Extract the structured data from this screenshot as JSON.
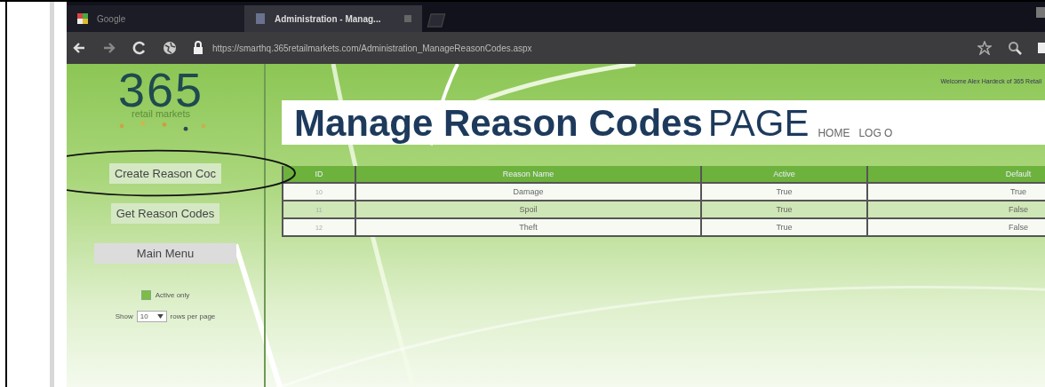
{
  "browser": {
    "tabs": [
      {
        "title": "Google",
        "selected": false
      },
      {
        "title": "Administration - Manag...",
        "selected": true
      }
    ],
    "url": "https://smarthq.365retailmarkets.com/Administration_ManageReasonCodes.aspx"
  },
  "header": {
    "logo_number": "365",
    "logo_tagline": "retail markets",
    "welcome": "Welcome Alex Hardeck of 365 Retail",
    "title": "Manage Reason Codes",
    "title_suffix": "PAGE",
    "nav": [
      "HOME",
      "LOG O"
    ]
  },
  "sidebar": {
    "buttons": [
      "Create Reason Coc",
      "Get Reason Codes",
      "Main Menu"
    ],
    "active_only": {
      "label": "Active only",
      "checked": true
    },
    "paging": {
      "prefix": "Show",
      "value": "10",
      "suffix": "rows per page"
    }
  },
  "table": {
    "columns": [
      "ID",
      "Reason Name",
      "Active",
      "Default"
    ],
    "rows": [
      {
        "cells": [
          "10",
          "Damage",
          "True",
          "True"
        ]
      },
      {
        "cells": [
          "11",
          "Spoil",
          "True",
          "False"
        ]
      },
      {
        "cells": [
          "12",
          "Theft",
          "True",
          "False"
        ]
      }
    ]
  }
}
